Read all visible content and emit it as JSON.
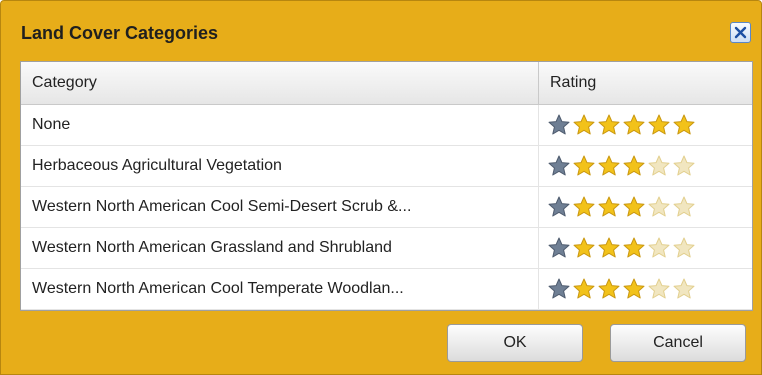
{
  "dialog": {
    "title": "Land Cover Categories",
    "close_icon": "close-icon"
  },
  "grid": {
    "columns": [
      "Category",
      "Rating"
    ],
    "max_rating": 6,
    "rows": [
      {
        "category": "None",
        "rating": 6
      },
      {
        "category": "Herbaceous Agricultural Vegetation",
        "rating": 4
      },
      {
        "category": "Western North American Cool Semi-Desert Scrub &...",
        "rating": 4
      },
      {
        "category": "Western North American Grassland and Shrubland",
        "rating": 4
      },
      {
        "category": "Western North American Cool Temperate Woodlan...",
        "rating": 4
      }
    ]
  },
  "buttons": {
    "ok": "OK",
    "cancel": "Cancel"
  },
  "colors": {
    "dialog_bg": "#e7ad19",
    "star_gold": "#f2c21a",
    "star_gray": "#6f7f94",
    "star_empty": "#f1e6c0"
  }
}
